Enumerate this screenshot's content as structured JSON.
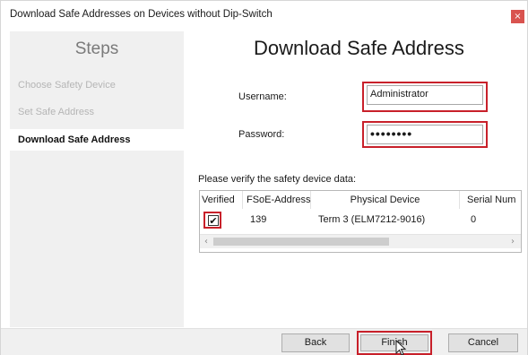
{
  "window": {
    "title": "Download Safe Addresses on Devices without Dip-Switch",
    "close_glyph": "×"
  },
  "sidebar": {
    "title": "Steps",
    "items": [
      {
        "label": "Choose Safety Device",
        "state": "completed"
      },
      {
        "label": "Set Safe Address",
        "state": "completed"
      },
      {
        "label": "Download Safe Address",
        "state": "active"
      }
    ]
  },
  "main": {
    "title": "Download Safe Address",
    "username_label": "Username:",
    "username_value": "Administrator",
    "password_label": "Password:",
    "password_value": "••••••••",
    "verify_text": "Please verify the safety device data:"
  },
  "grid": {
    "columns": [
      "Verified",
      "FSoE-Address",
      "Physical Device",
      "Serial Num"
    ],
    "rows": [
      {
        "verified": true,
        "check_glyph": "✔",
        "fsoe_address": "139",
        "physical_device": "Term 3 (ELM7212-9016)",
        "serial": "0"
      }
    ],
    "scroll_left": "‹",
    "scroll_right": "›"
  },
  "buttons": {
    "back": "Back",
    "finish": "Finish",
    "cancel": "Cancel"
  },
  "colors": {
    "highlight": "#c8202a",
    "sidebar_bg": "#f0f0f0",
    "footer_bg": "#f0f0f0"
  }
}
